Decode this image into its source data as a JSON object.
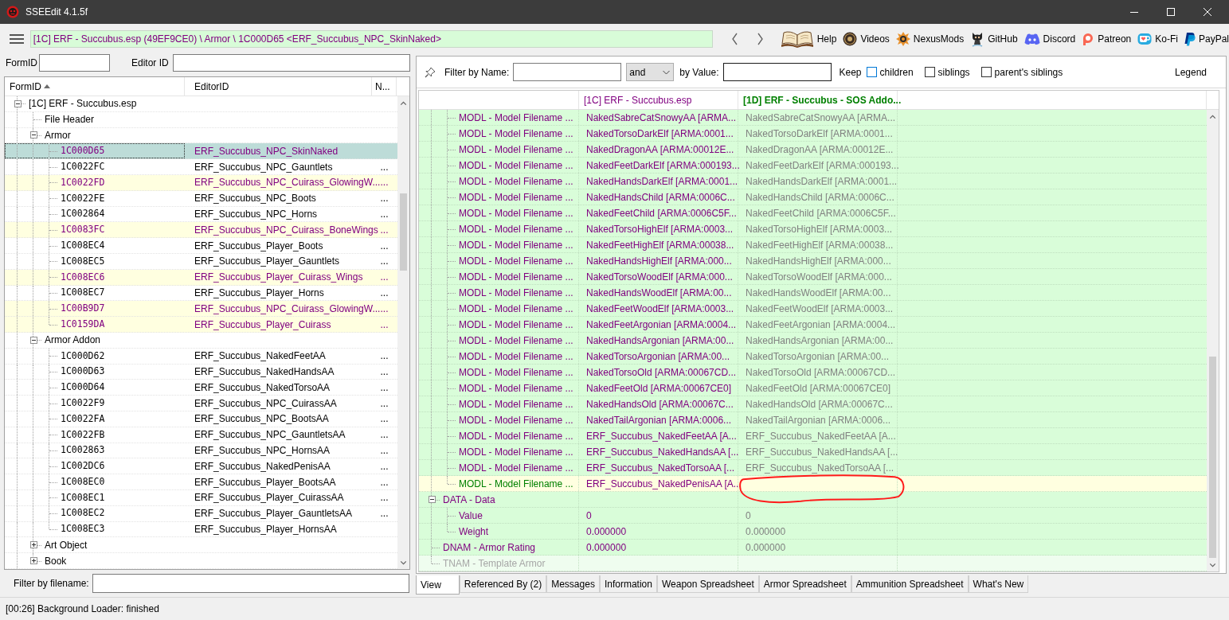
{
  "window": {
    "title": "SSEEdit 4.1.5f"
  },
  "toolbar": {
    "breadcrumb": "[1C] ERF - Succubus.esp (49EF9CE0) \\ Armor \\ 1C000D65 <ERF_Succubus_NPC_SkinNaked>",
    "links": [
      {
        "kind": "book",
        "label": "Help"
      },
      {
        "kind": "disc",
        "label": "Videos"
      },
      {
        "kind": "cog",
        "label": "NexusMods"
      },
      {
        "kind": "cat",
        "label": "GitHub"
      },
      {
        "kind": "pad",
        "label": "Discord"
      },
      {
        "kind": "ring",
        "label": "Patreon"
      },
      {
        "kind": "cup",
        "label": "Ko-Fi"
      },
      {
        "kind": "p",
        "label": "PayPal"
      }
    ]
  },
  "left_panel": {
    "form_id_label": "FormID",
    "editor_id_label": "Editor ID",
    "tree": {
      "columns": [
        {
          "label": "FormID",
          "sorted": true
        },
        {
          "label": "EditorID",
          "sorted": false
        },
        {
          "label": "N...",
          "sorted": false
        }
      ],
      "rows": [
        {
          "label": "[1C] ERF - Succubus.esp",
          "expanded": true,
          "selected": false,
          "conflict": false,
          "children": [
            {
              "label": "File Header",
              "selected": false,
              "conflict": false
            },
            {
              "label": "Armor",
              "expanded": true,
              "selected": false,
              "conflict": false,
              "children": [
                {
                  "form_id": "1C000D65",
                  "editor_id": "ERF_Succubus_NPC_SkinNaked",
                  "selected": true,
                  "conflict": true
                },
                {
                  "form_id": "1C0022FC",
                  "editor_id": "ERF_Succubus_NPC_Gauntlets",
                  "column_3": "...",
                  "selected": false,
                  "conflict": false
                },
                {
                  "form_id": "1C0022FD",
                  "editor_id": "ERF_Succubus_NPC_Cuirass_GlowingW...",
                  "column_3": "...",
                  "selected": false,
                  "conflict": true
                },
                {
                  "form_id": "1C0022FE",
                  "editor_id": "ERF_Succubus_NPC_Boots",
                  "column_3": "...",
                  "selected": false,
                  "conflict": false
                },
                {
                  "form_id": "1C002864",
                  "editor_id": "ERF_Succubus_NPC_Horns",
                  "column_3": "...",
                  "selected": false,
                  "conflict": false
                },
                {
                  "form_id": "1C0083FC",
                  "editor_id": "ERF_Succubus_NPC_Cuirass_BoneWings",
                  "column_3": "...",
                  "selected": false,
                  "conflict": true
                },
                {
                  "form_id": "1C008EC4",
                  "editor_id": "ERF_Succubus_Player_Boots",
                  "column_3": "...",
                  "selected": false,
                  "conflict": false
                },
                {
                  "form_id": "1C008EC5",
                  "editor_id": "ERF_Succubus_Player_Gauntlets",
                  "column_3": "...",
                  "selected": false,
                  "conflict": false
                },
                {
                  "form_id": "1C008EC6",
                  "editor_id": "ERF_Succubus_Player_Cuirass_Wings",
                  "column_3": "...",
                  "selected": false,
                  "conflict": true
                },
                {
                  "form_id": "1C008EC7",
                  "editor_id": "ERF_Succubus_Player_Horns",
                  "column_3": "...",
                  "selected": false,
                  "conflict": false
                },
                {
                  "form_id": "1C00B9D7",
                  "editor_id": "ERF_Succubus_NPC_Cuirass_GlowingW...",
                  "column_3": "...",
                  "selected": false,
                  "conflict": true
                },
                {
                  "form_id": "1C0159DA",
                  "editor_id": "ERF_Succubus_Player_Cuirass",
                  "column_3": "...",
                  "selected": false,
                  "conflict": true
                }
              ]
            },
            {
              "label": "Armor Addon",
              "expanded": true,
              "selected": false,
              "conflict": false,
              "children": [
                {
                  "form_id": "1C000D62",
                  "editor_id": "ERF_Succubus_NakedFeetAA",
                  "column_3": "...",
                  "selected": false,
                  "conflict": false
                },
                {
                  "form_id": "1C000D63",
                  "editor_id": "ERF_Succubus_NakedHandsAA",
                  "column_3": "...",
                  "selected": false,
                  "conflict": false
                },
                {
                  "form_id": "1C000D64",
                  "editor_id": "ERF_Succubus_NakedTorsoAA",
                  "column_3": "...",
                  "selected": false,
                  "conflict": false
                },
                {
                  "form_id": "1C0022F9",
                  "editor_id": "ERF_Succubus_NPC_CuirassAA",
                  "column_3": "...",
                  "selected": false,
                  "conflict": false
                },
                {
                  "form_id": "1C0022FA",
                  "editor_id": "ERF_Succubus_NPC_BootsAA",
                  "column_3": "...",
                  "selected": false,
                  "conflict": false
                },
                {
                  "form_id": "1C0022FB",
                  "editor_id": "ERF_Succubus_NPC_GauntletsAA",
                  "column_3": "...",
                  "selected": false,
                  "conflict": false
                },
                {
                  "form_id": "1C002863",
                  "editor_id": "ERF_Succubus_NPC_HornsAA",
                  "column_3": "...",
                  "selected": false,
                  "conflict": false
                },
                {
                  "form_id": "1C002DC6",
                  "editor_id": "ERF_Succubus_NakedPenisAA",
                  "column_3": "...",
                  "selected": false,
                  "conflict": false
                },
                {
                  "form_id": "1C008EC0",
                  "editor_id": "ERF_Succubus_Player_BootsAA",
                  "column_3": "...",
                  "selected": false,
                  "conflict": false
                },
                {
                  "form_id": "1C008EC1",
                  "editor_id": "ERF_Succubus_Player_CuirassAA",
                  "column_3": "...",
                  "selected": false,
                  "conflict": false
                },
                {
                  "form_id": "1C008EC2",
                  "editor_id": "ERF_Succubus_Player_GauntletsAA",
                  "column_3": "...",
                  "selected": false,
                  "conflict": false
                },
                {
                  "form_id": "1C008EC3",
                  "editor_id": "ERF_Succubus_Player_HornsAA",
                  "selected": false,
                  "conflict": false
                }
              ]
            },
            {
              "label": "Art Object",
              "expanded": false,
              "selected": false,
              "conflict": false
            },
            {
              "label": "Book",
              "expanded": false,
              "selected": false,
              "conflict": false
            }
          ]
        }
      ]
    },
    "filter_label": "Filter by filename:"
  },
  "right_panel": {
    "filter": {
      "name_label": "Filter by Name:",
      "operator": "and",
      "value_label": "by Value:",
      "keep_label": "Keep",
      "options": [
        {
          "label": "children",
          "checked": false,
          "focused": true
        },
        {
          "label": "siblings",
          "checked": false,
          "focused": false
        },
        {
          "label": "parent's siblings",
          "checked": false,
          "focused": false
        }
      ],
      "legend": "Legend"
    },
    "grid": {
      "columns": [
        {
          "label": "[1C] ERF - Succubus.esp",
          "color": "#800080",
          "winning": false,
          "dimmed": false
        },
        {
          "label": "[1D] ERF - Succubus - SOS Addo...",
          "color": "#008000",
          "winning": true,
          "dimmed": true
        }
      ],
      "rows": [
        {
          "children": [
            {
              "label": "MODL - Model Filename ...",
              "values": [
                "NakedSabreCatSnowyAA [ARMA...",
                "NakedSabreCatSnowyAA [ARMA..."
              ],
              "conflict": false,
              "disabled": false
            },
            {
              "label": "MODL - Model Filename ...",
              "values": [
                "NakedTorsoDarkElf [ARMA:0001...",
                "NakedTorsoDarkElf [ARMA:0001..."
              ],
              "conflict": false,
              "disabled": false
            },
            {
              "label": "MODL - Model Filename ...",
              "values": [
                "NakedDragonAA [ARMA:00012E...",
                "NakedDragonAA [ARMA:00012E..."
              ],
              "conflict": false,
              "disabled": false
            },
            {
              "label": "MODL - Model Filename ...",
              "values": [
                "NakedFeetDarkElf [ARMA:000193...",
                "NakedFeetDarkElf [ARMA:000193..."
              ],
              "conflict": false,
              "disabled": false
            },
            {
              "label": "MODL - Model Filename ...",
              "values": [
                "NakedHandsDarkElf [ARMA:0001...",
                "NakedHandsDarkElf [ARMA:0001..."
              ],
              "conflict": false,
              "disabled": false
            },
            {
              "label": "MODL - Model Filename ...",
              "values": [
                "NakedHandsChild [ARMA:0006C...",
                "NakedHandsChild [ARMA:0006C..."
              ],
              "conflict": false,
              "disabled": false
            },
            {
              "label": "MODL - Model Filename ...",
              "values": [
                "NakedFeetChild [ARMA:0006C5F...",
                "NakedFeetChild [ARMA:0006C5F..."
              ],
              "conflict": false,
              "disabled": false
            },
            {
              "label": "MODL - Model Filename ...",
              "values": [
                "NakedTorsoHighElf [ARMA:0003...",
                "NakedTorsoHighElf [ARMA:0003..."
              ],
              "conflict": false,
              "disabled": false
            },
            {
              "label": "MODL - Model Filename ...",
              "values": [
                "NakedFeetHighElf [ARMA:00038...",
                "NakedFeetHighElf [ARMA:00038..."
              ],
              "conflict": false,
              "disabled": false
            },
            {
              "label": "MODL - Model Filename ...",
              "values": [
                "NakedHandsHighElf [ARMA:000...",
                "NakedHandsHighElf [ARMA:000..."
              ],
              "conflict": false,
              "disabled": false
            },
            {
              "label": "MODL - Model Filename ...",
              "values": [
                "NakedTorsoWoodElf [ARMA:000...",
                "NakedTorsoWoodElf [ARMA:000..."
              ],
              "conflict": false,
              "disabled": false
            },
            {
              "label": "MODL - Model Filename ...",
              "values": [
                "NakedHandsWoodElf [ARMA:00...",
                "NakedHandsWoodElf [ARMA:00..."
              ],
              "conflict": false,
              "disabled": false
            },
            {
              "label": "MODL - Model Filename ...",
              "values": [
                "NakedFeetWoodElf [ARMA:0003...",
                "NakedFeetWoodElf [ARMA:0003..."
              ],
              "conflict": false,
              "disabled": false
            },
            {
              "label": "MODL - Model Filename ...",
              "values": [
                "NakedFeetArgonian [ARMA:0004...",
                "NakedFeetArgonian [ARMA:0004..."
              ],
              "conflict": false,
              "disabled": false
            },
            {
              "label": "MODL - Model Filename ...",
              "values": [
                "NakedHandsArgonian [ARMA:00...",
                "NakedHandsArgonian [ARMA:00..."
              ],
              "conflict": false,
              "disabled": false
            },
            {
              "label": "MODL - Model Filename ...",
              "values": [
                "NakedTorsoArgonian [ARMA:00...",
                "NakedTorsoArgonian [ARMA:00..."
              ],
              "conflict": false,
              "disabled": false
            },
            {
              "label": "MODL - Model Filename ...",
              "values": [
                "NakedTorsoOld [ARMA:00067CD...",
                "NakedTorsoOld [ARMA:00067CD..."
              ],
              "conflict": false,
              "disabled": false
            },
            {
              "label": "MODL - Model Filename ...",
              "values": [
                "NakedFeetOld [ARMA:00067CE0]",
                "NakedFeetOld [ARMA:00067CE0]"
              ],
              "conflict": false,
              "disabled": false
            },
            {
              "label": "MODL - Model Filename ...",
              "values": [
                "NakedHandsOld [ARMA:00067C...",
                "NakedHandsOld [ARMA:00067C..."
              ],
              "conflict": false,
              "disabled": false
            },
            {
              "label": "MODL - Model Filename ...",
              "values": [
                "NakedTailArgonian [ARMA:0006...",
                "NakedTailArgonian [ARMA:0006..."
              ],
              "conflict": false,
              "disabled": false
            },
            {
              "label": "MODL - Model Filename ...",
              "values": [
                "ERF_Succubus_NakedFeetAA [A...",
                "ERF_Succubus_NakedFeetAA [A..."
              ],
              "conflict": false,
              "disabled": false
            },
            {
              "label": "MODL - Model Filename ...",
              "values": [
                "ERF_Succubus_NakedHandsAA [...",
                "ERF_Succubus_NakedHandsAA [..."
              ],
              "conflict": false,
              "disabled": false
            },
            {
              "label": "MODL - Model Filename ...",
              "values": [
                "ERF_Succubus_NakedTorsoAA [...",
                "ERF_Succubus_NakedTorsoAA [..."
              ],
              "conflict": false,
              "disabled": false
            },
            {
              "label": "MODL - Model Filename ...",
              "values": [
                "ERF_Succubus_NakedPenisAA [A..."
              ],
              "conflict": true,
              "disabled": false
            }
          ]
        },
        {
          "label": "DATA - Data",
          "expanded": true,
          "conflict": false,
          "disabled": false,
          "children": [
            {
              "label": "Value",
              "values": [
                "0",
                "0"
              ],
              "conflict": false,
              "disabled": false
            },
            {
              "label": "Weight",
              "values": [
                "0.000000",
                "0.000000"
              ],
              "conflict": false,
              "disabled": false
            }
          ]
        },
        {
          "label": "DNAM - Armor Rating",
          "values": [
            "0.000000",
            "0.000000"
          ],
          "conflict": false,
          "disabled": false
        },
        {
          "label": "TNAM - Template Armor",
          "conflict": false,
          "disabled": true
        }
      ]
    },
    "tabs": [
      {
        "label": "View",
        "selected": true
      },
      {
        "label": "Referenced By (2)",
        "selected": false
      },
      {
        "label": "Messages",
        "selected": false
      },
      {
        "label": "Information",
        "selected": false
      },
      {
        "label": "Weapon Spreadsheet",
        "selected": false
      },
      {
        "label": "Armor Spreadsheet",
        "selected": false
      },
      {
        "label": "Ammunition Spreadsheet",
        "selected": false
      },
      {
        "label": "What's New",
        "selected": false
      }
    ]
  },
  "status_bar": {
    "text": "[00:26] Background Loader: finished"
  }
}
